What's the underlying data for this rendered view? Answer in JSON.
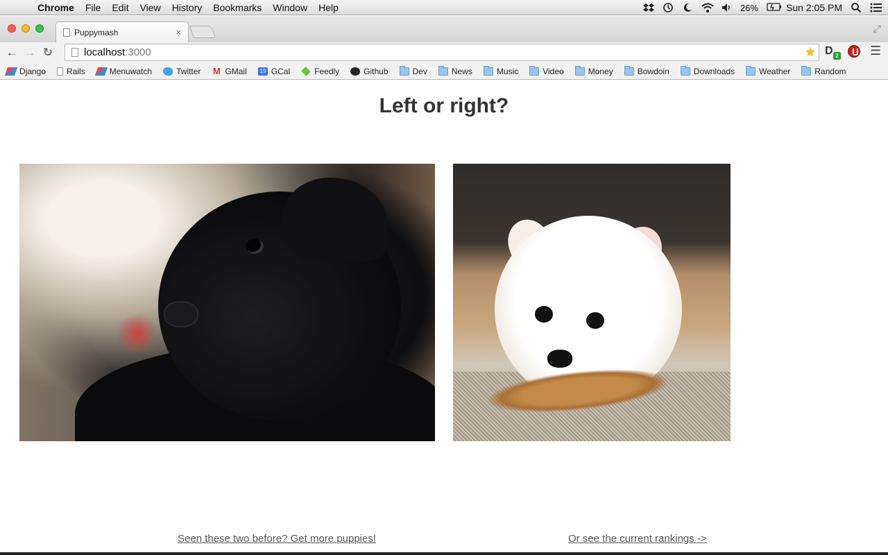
{
  "menubar": {
    "app_name": "Chrome",
    "items": [
      "File",
      "Edit",
      "View",
      "History",
      "Bookmarks",
      "Window",
      "Help"
    ],
    "battery": "26%",
    "clock": "Sun 2:05 PM"
  },
  "tab": {
    "title": "Puppymash",
    "close_glyph": "×"
  },
  "address_bar": {
    "host": "localhost",
    "port": ":3000"
  },
  "extensions": {
    "d_label": "D",
    "d_badge": "2"
  },
  "bookmarks": [
    {
      "label": "Django",
      "icon": "django-icon"
    },
    {
      "label": "Rails",
      "icon": "page-icon"
    },
    {
      "label": "Menuwatch",
      "icon": "django-icon"
    },
    {
      "label": "Twitter",
      "icon": "twitter-icon"
    },
    {
      "label": "GMail",
      "icon": "gmail-icon"
    },
    {
      "label": "GCal",
      "icon": "gcal-icon"
    },
    {
      "label": "Feedly",
      "icon": "feedly-icon"
    },
    {
      "label": "Github",
      "icon": "github-icon"
    },
    {
      "label": "Dev",
      "icon": "folder-icon"
    },
    {
      "label": "News",
      "icon": "folder-icon"
    },
    {
      "label": "Music",
      "icon": "folder-icon"
    },
    {
      "label": "Video",
      "icon": "folder-icon"
    },
    {
      "label": "Money",
      "icon": "folder-icon"
    },
    {
      "label": "Bowdoin",
      "icon": "folder-icon"
    },
    {
      "label": "Downloads",
      "icon": "folder-icon"
    },
    {
      "label": "Weather",
      "icon": "folder-icon"
    },
    {
      "label": "Random",
      "icon": "folder-icon"
    }
  ],
  "gcal_day": "19",
  "page": {
    "heading": "Left or right?",
    "more_link": "Seen these two before? Get more puppies!",
    "rankings_link": "Or see the current rankings ->"
  }
}
